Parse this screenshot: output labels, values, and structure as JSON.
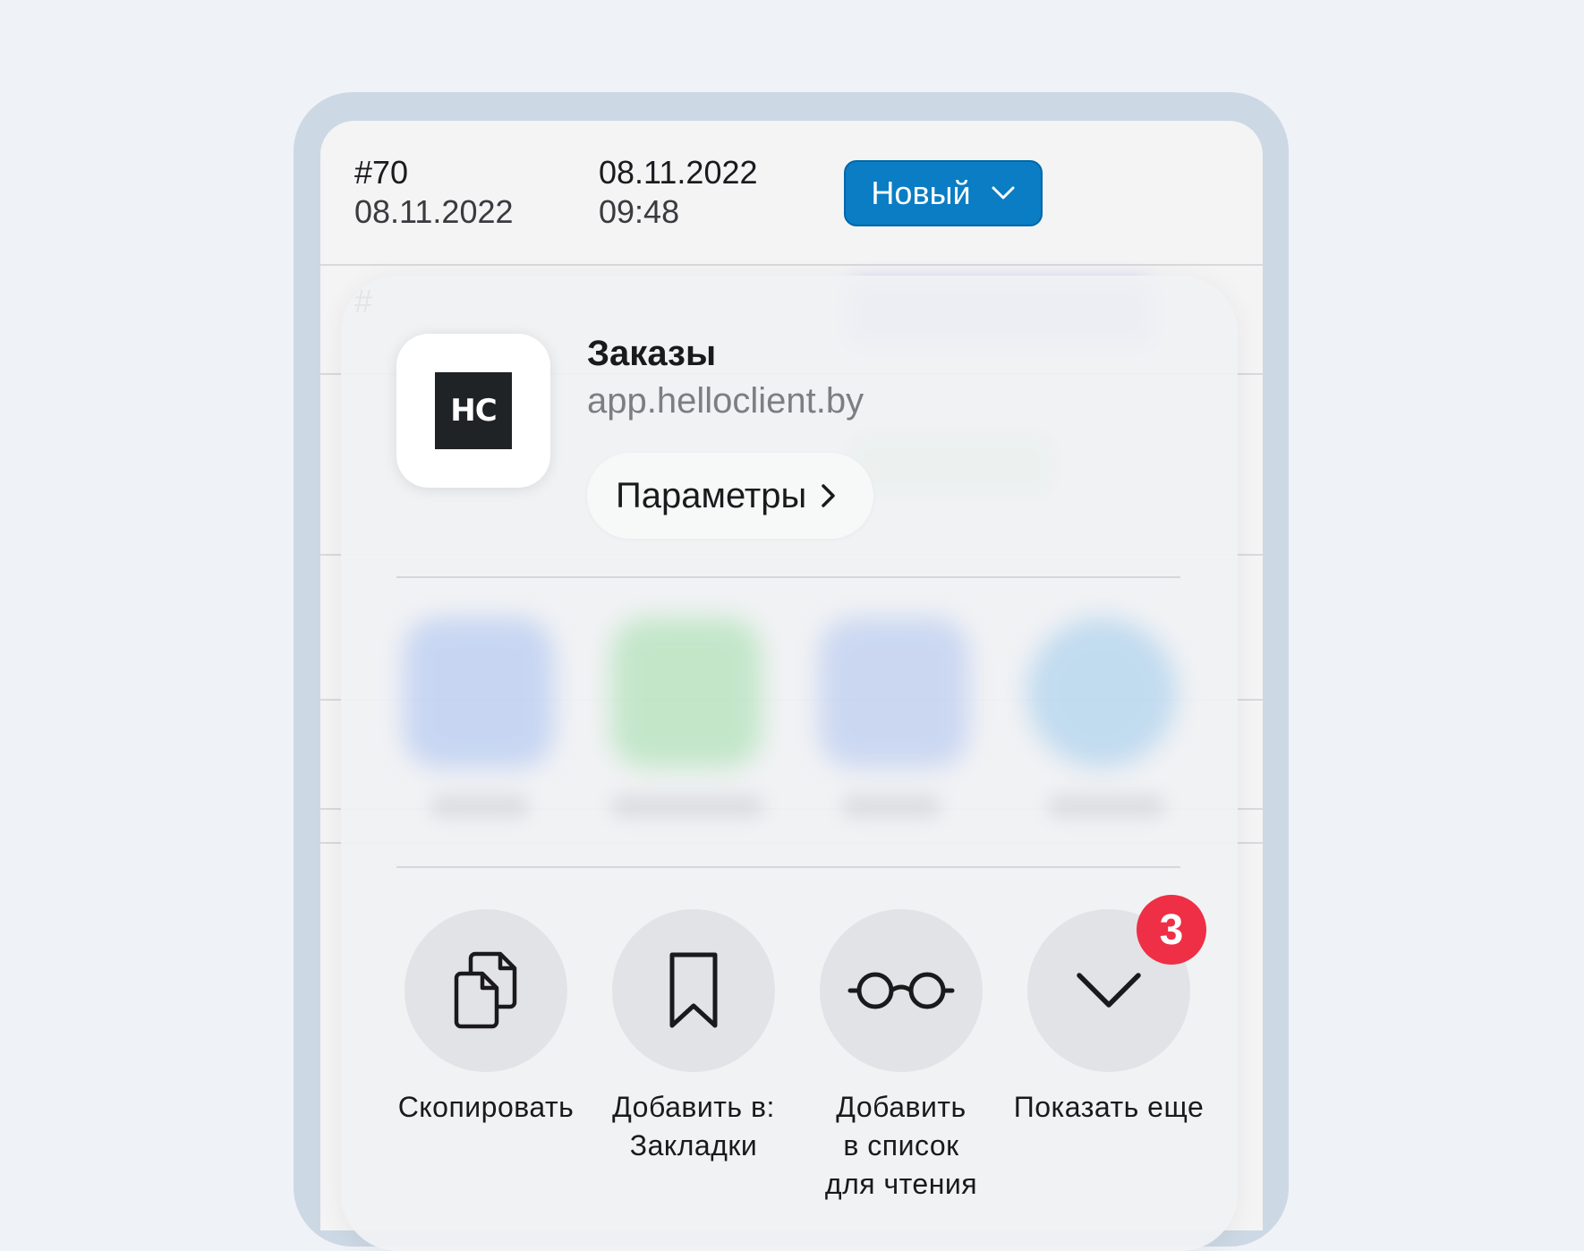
{
  "orders": {
    "row1": {
      "number": "#70",
      "created_date": "08.11.2022",
      "date": "08.11.2022",
      "time": "09:48",
      "status_label": "Новый"
    },
    "row2_partial_number": "#"
  },
  "share_sheet": {
    "app_icon_text": "HC",
    "title": "Заказы",
    "url": "app.helloclient.by",
    "params_label": "Параметры",
    "actions": [
      {
        "label_line1": "Скопировать",
        "label_line2": "",
        "label_line3": "",
        "icon": "copy-icon"
      },
      {
        "label_line1": "Добавить в:",
        "label_line2": "Закладки",
        "label_line3": "",
        "icon": "bookmark-icon"
      },
      {
        "label_line1": "Добавить",
        "label_line2": "в список",
        "label_line3": "для чтения",
        "icon": "glasses-icon"
      },
      {
        "label_line1": "Показать еще",
        "label_line2": "",
        "label_line3": "",
        "icon": "chevron-down-icon",
        "badge": "3"
      }
    ]
  },
  "colors": {
    "status_button": "#0a7dc4",
    "badge": "#ee2f45",
    "phone_frame": "#cdd8e5"
  }
}
